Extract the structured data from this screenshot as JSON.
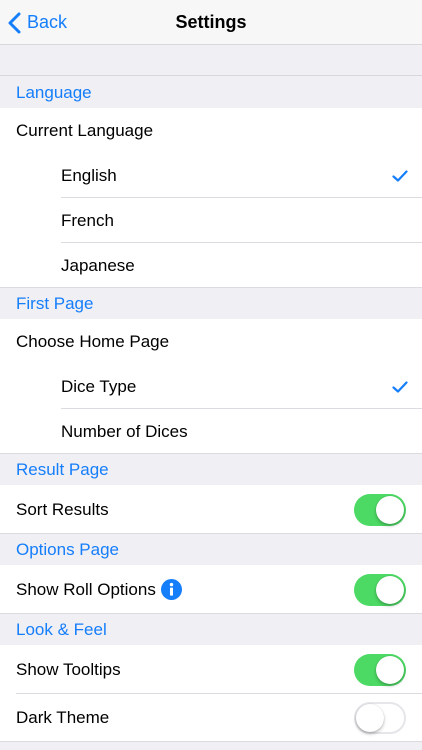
{
  "nav": {
    "back_label": "Back",
    "title": "Settings"
  },
  "sections": {
    "language": {
      "header": "Language",
      "row_label": "Current Language",
      "options": [
        "English",
        "French",
        "Japanese"
      ],
      "selected": "English"
    },
    "first_page": {
      "header": "First Page",
      "row_label": "Choose Home Page",
      "options": [
        "Dice Type",
        "Number of Dices"
      ],
      "selected": "Dice Type"
    },
    "result_page": {
      "header": "Result Page",
      "sort_results": {
        "label": "Sort Results",
        "on": true
      }
    },
    "options_page": {
      "header": "Options Page",
      "show_roll_options": {
        "label": "Show Roll Options",
        "on": true
      }
    },
    "look_feel": {
      "header": "Look & Feel",
      "show_tooltips": {
        "label": "Show Tooltips",
        "on": true
      },
      "dark_theme": {
        "label": "Dark Theme",
        "on": false
      }
    }
  },
  "colors": {
    "accent": "#157efb",
    "switch_on": "#4cd964",
    "background": "#efeff4"
  },
  "icons": {
    "back": "chevron-left-icon",
    "check": "checkmark-icon",
    "info": "info-icon"
  }
}
